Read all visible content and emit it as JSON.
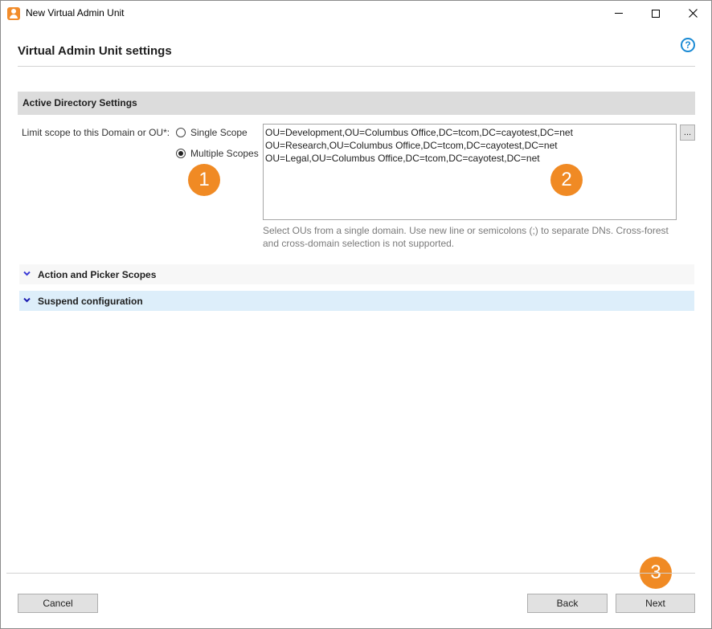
{
  "window": {
    "title": "New Virtual Admin Unit"
  },
  "header": {
    "title": "Virtual Admin Unit settings",
    "help_glyph": "?"
  },
  "section": {
    "title": "Active Directory Settings"
  },
  "scope": {
    "label": "Limit scope to this Domain or OU*:",
    "options": [
      {
        "label": "Single Scope",
        "checked": false
      },
      {
        "label": "Multiple Scopes",
        "checked": true
      }
    ],
    "ou_lines": [
      "OU=Development,OU=Columbus Office,DC=tcom,DC=cayotest,DC=net",
      "OU=Research,OU=Columbus Office,DC=tcom,DC=cayotest,DC=net",
      "OU=Legal,OU=Columbus Office,DC=tcom,DC=cayotest,DC=net"
    ],
    "browse_label": "...",
    "hint": "Select OUs from a single domain. Use new line or semicolons (;) to separate DNs. Cross-forest and cross-domain selection is not supported."
  },
  "expanders": [
    {
      "label": "Action and Picker Scopes"
    },
    {
      "label": "Suspend configuration"
    }
  ],
  "badges": [
    "1",
    "2",
    "3"
  ],
  "buttons": {
    "cancel": "Cancel",
    "back": "Back",
    "next": "Next"
  },
  "colors": {
    "badge": "#f08a24",
    "help": "#1a8ad4",
    "section_bg": "#dcdcdc",
    "suspend_bg": "#ddeefa",
    "chevron": "#3b3bd6"
  }
}
